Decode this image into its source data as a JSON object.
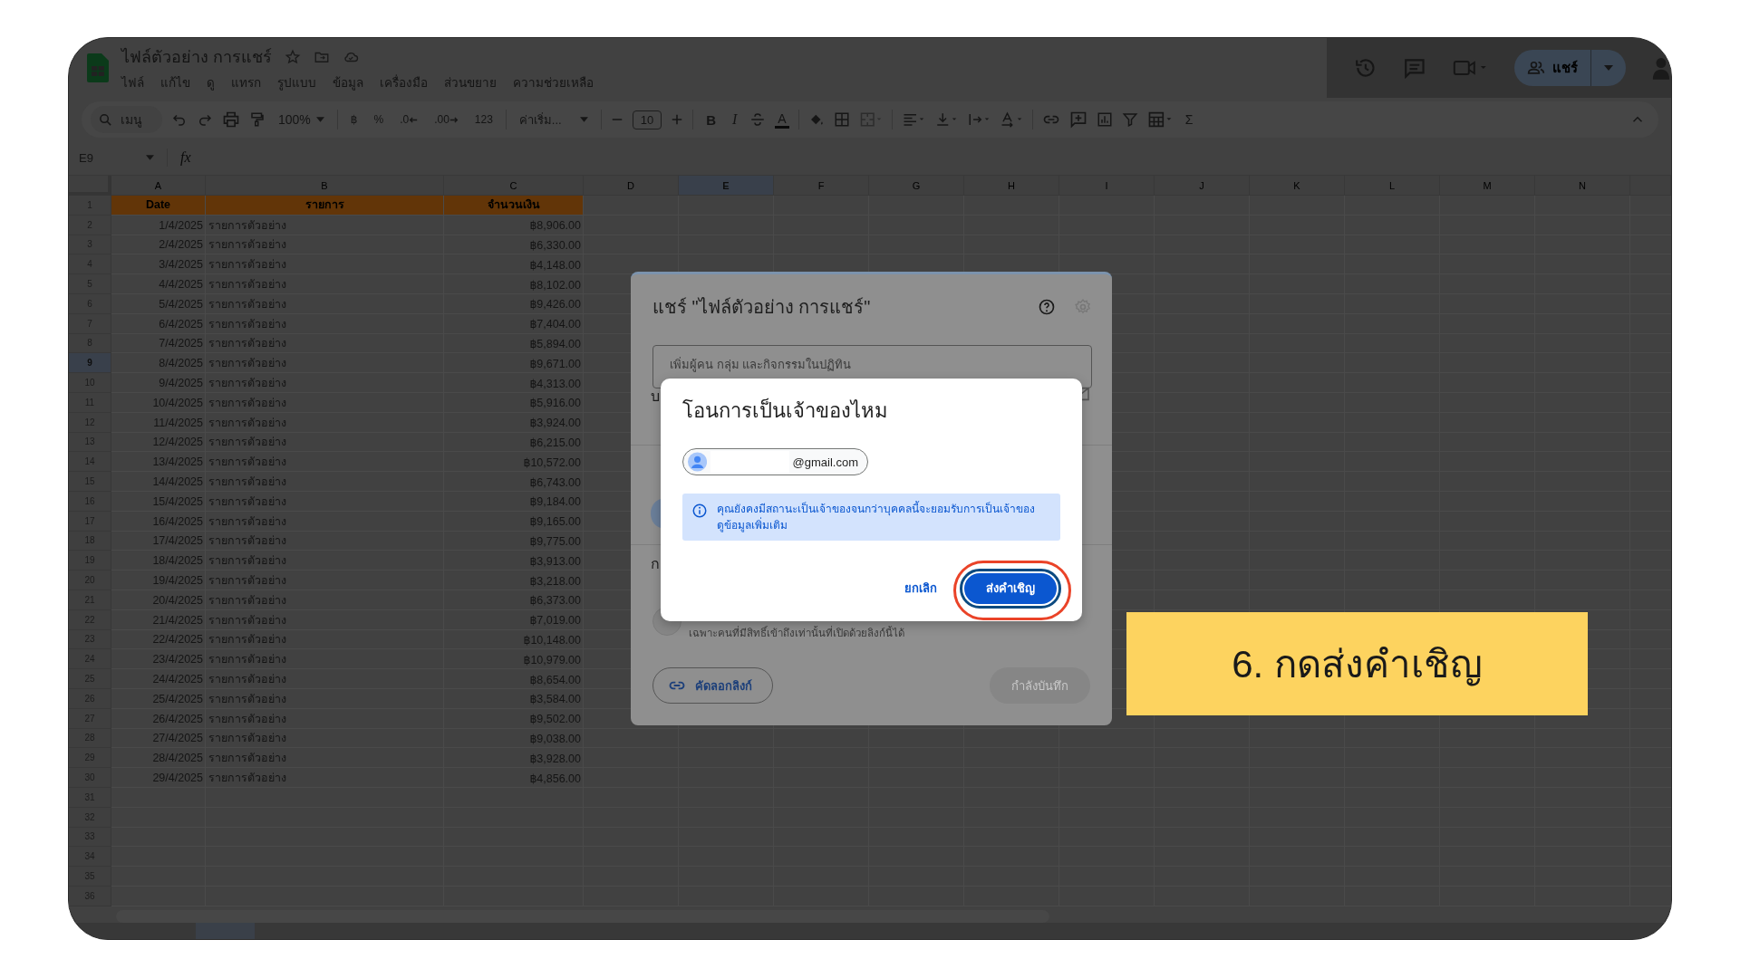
{
  "document": {
    "title": "ไฟล์ตัวอย่าง การแชร์",
    "menu": [
      "ไฟล์",
      "แก้ไข",
      "ดู",
      "แทรก",
      "รูปแบบ",
      "ข้อมูล",
      "เครื่องมือ",
      "ส่วนขยาย",
      "ความช่วยเหลือ"
    ]
  },
  "share_button": {
    "label": "แชร์"
  },
  "toolbar": {
    "search": "เมนู",
    "zoom": "100%",
    "currency": "฿",
    "percent": "%",
    "decimal_less": ".0",
    "decimal_more": ".00",
    "number_format": "123",
    "font": "ค่าเริ่ม...",
    "font_size": "10",
    "bold": "B",
    "italic": "I",
    "text_color": "A",
    "sum": "Σ"
  },
  "formula_bar": {
    "name_box": "E9",
    "fx": "fx"
  },
  "sheet": {
    "columns": [
      {
        "label": "A",
        "selected": false
      },
      {
        "label": "B",
        "selected": false
      },
      {
        "label": "C",
        "selected": false
      },
      {
        "label": "D",
        "selected": false
      },
      {
        "label": "E",
        "selected": true
      },
      {
        "label": "F",
        "selected": false
      },
      {
        "label": "G",
        "selected": false
      },
      {
        "label": "H",
        "selected": false
      },
      {
        "label": "I",
        "selected": false
      },
      {
        "label": "J",
        "selected": false
      },
      {
        "label": "K",
        "selected": false
      },
      {
        "label": "L",
        "selected": false
      },
      {
        "label": "M",
        "selected": false
      },
      {
        "label": "N",
        "selected": false
      }
    ],
    "rows": [
      {
        "number": "1",
        "selected": false,
        "kind": "header",
        "date": "Date",
        "item": "รายการ",
        "amount": "จำนวนเงิน"
      },
      {
        "number": "2",
        "selected": false,
        "kind": "data",
        "date": "1/4/2025",
        "item": "รายการตัวอย่าง",
        "amount": "฿8,906.00"
      },
      {
        "number": "3",
        "selected": false,
        "kind": "data",
        "date": "2/4/2025",
        "item": "รายการตัวอย่าง",
        "amount": "฿6,330.00"
      },
      {
        "number": "4",
        "selected": false,
        "kind": "data",
        "date": "3/4/2025",
        "item": "รายการตัวอย่าง",
        "amount": "฿4,148.00"
      },
      {
        "number": "5",
        "selected": false,
        "kind": "data",
        "date": "4/4/2025",
        "item": "รายการตัวอย่าง",
        "amount": "฿8,102.00"
      },
      {
        "number": "6",
        "selected": false,
        "kind": "data",
        "date": "5/4/2025",
        "item": "รายการตัวอย่าง",
        "amount": "฿9,426.00"
      },
      {
        "number": "7",
        "selected": false,
        "kind": "data",
        "date": "6/4/2025",
        "item": "รายการตัวอย่าง",
        "amount": "฿7,404.00"
      },
      {
        "number": "8",
        "selected": false,
        "kind": "data",
        "date": "7/4/2025",
        "item": "รายการตัวอย่าง",
        "amount": "฿5,894.00"
      },
      {
        "number": "9",
        "selected": true,
        "kind": "data",
        "date": "8/4/2025",
        "item": "รายการตัวอย่าง",
        "amount": "฿9,671.00"
      },
      {
        "number": "10",
        "selected": false,
        "kind": "data",
        "date": "9/4/2025",
        "item": "รายการตัวอย่าง",
        "amount": "฿4,313.00"
      },
      {
        "number": "11",
        "selected": false,
        "kind": "data",
        "date": "10/4/2025",
        "item": "รายการตัวอย่าง",
        "amount": "฿5,916.00"
      },
      {
        "number": "12",
        "selected": false,
        "kind": "data",
        "date": "11/4/2025",
        "item": "รายการตัวอย่าง",
        "amount": "฿3,924.00"
      },
      {
        "number": "13",
        "selected": false,
        "kind": "data",
        "date": "12/4/2025",
        "item": "รายการตัวอย่าง",
        "amount": "฿6,215.00"
      },
      {
        "number": "14",
        "selected": false,
        "kind": "data",
        "date": "13/4/2025",
        "item": "รายการตัวอย่าง",
        "amount": "฿10,572.00"
      },
      {
        "number": "15",
        "selected": false,
        "kind": "data",
        "date": "14/4/2025",
        "item": "รายการตัวอย่าง",
        "amount": "฿6,743.00"
      },
      {
        "number": "16",
        "selected": false,
        "kind": "data",
        "date": "15/4/2025",
        "item": "รายการตัวอย่าง",
        "amount": "฿9,184.00"
      },
      {
        "number": "17",
        "selected": false,
        "kind": "data",
        "date": "16/4/2025",
        "item": "รายการตัวอย่าง",
        "amount": "฿9,165.00"
      },
      {
        "number": "18",
        "selected": false,
        "kind": "data",
        "date": "17/4/2025",
        "item": "รายการตัวอย่าง",
        "amount": "฿9,775.00"
      },
      {
        "number": "19",
        "selected": false,
        "kind": "data",
        "date": "18/4/2025",
        "item": "รายการตัวอย่าง",
        "amount": "฿3,913.00"
      },
      {
        "number": "20",
        "selected": false,
        "kind": "data",
        "date": "19/4/2025",
        "item": "รายการตัวอย่าง",
        "amount": "฿3,218.00"
      },
      {
        "number": "21",
        "selected": false,
        "kind": "data",
        "date": "20/4/2025",
        "item": "รายการตัวอย่าง",
        "amount": "฿6,373.00"
      },
      {
        "number": "22",
        "selected": false,
        "kind": "data",
        "date": "21/4/2025",
        "item": "รายการตัวอย่าง",
        "amount": "฿7,019.00"
      },
      {
        "number": "23",
        "selected": false,
        "kind": "data",
        "date": "22/4/2025",
        "item": "รายการตัวอย่าง",
        "amount": "฿10,148.00"
      },
      {
        "number": "24",
        "selected": false,
        "kind": "data",
        "date": "23/4/2025",
        "item": "รายการตัวอย่าง",
        "amount": "฿10,979.00"
      },
      {
        "number": "25",
        "selected": false,
        "kind": "data",
        "date": "24/4/2025",
        "item": "รายการตัวอย่าง",
        "amount": "฿8,654.00"
      },
      {
        "number": "26",
        "selected": false,
        "kind": "data",
        "date": "25/4/2025",
        "item": "รายการตัวอย่าง",
        "amount": "฿3,584.00"
      },
      {
        "number": "27",
        "selected": false,
        "kind": "data",
        "date": "26/4/2025",
        "item": "รายการตัวอย่าง",
        "amount": "฿9,502.00"
      },
      {
        "number": "28",
        "selected": false,
        "kind": "data",
        "date": "27/4/2025",
        "item": "รายการตัวอย่าง",
        "amount": "฿9,038.00"
      },
      {
        "number": "29",
        "selected": false,
        "kind": "data",
        "date": "28/4/2025",
        "item": "รายการตัวอย่าง",
        "amount": "฿3,928.00"
      },
      {
        "number": "30",
        "selected": false,
        "kind": "data",
        "date": "29/4/2025",
        "item": "รายการตัวอย่าง",
        "amount": "฿4,856.00"
      },
      {
        "number": "31",
        "selected": false,
        "kind": "empty"
      },
      {
        "number": "32",
        "selected": false,
        "kind": "empty"
      },
      {
        "number": "33",
        "selected": false,
        "kind": "empty"
      },
      {
        "number": "34",
        "selected": false,
        "kind": "empty"
      },
      {
        "number": "35",
        "selected": false,
        "kind": "empty"
      },
      {
        "number": "36",
        "selected": false,
        "kind": "empty"
      }
    ]
  },
  "share_dialog": {
    "title": "แชร์ \"ไฟล์ตัวอย่าง การแชร์\"",
    "add_people_placeholder": "เพิ่มผู้คน กลุ่ม และกิจกรรมในปฏิทิน",
    "cut_labels": [
      "บ",
      "ก"
    ],
    "link_access_note": "เฉพาะคนที่มีสิทธิ์เข้าถึงเท่านั้นที่เปิดด้วยลิงก์นี้ได้",
    "copy_link": "คัดลอกลิงก์",
    "save_button": {
      "label": "กำลังบันทึก",
      "disabled": true
    }
  },
  "transfer_dialog": {
    "title": "โอนการเป็นเจ้าของไหม",
    "recipient": "@gmail.com",
    "notice": "คุณยังคงมีสถานะเป็นเจ้าของจนกว่าบุคคลนี้จะยอมรับการเป็นเจ้าของ",
    "notice_link": "ดูข้อมูลเพิ่มเติม",
    "cancel": "ยกเลิก",
    "send": "ส่งคำเชิญ"
  },
  "callout": {
    "text": "6. กดส่งคำเชิญ"
  }
}
